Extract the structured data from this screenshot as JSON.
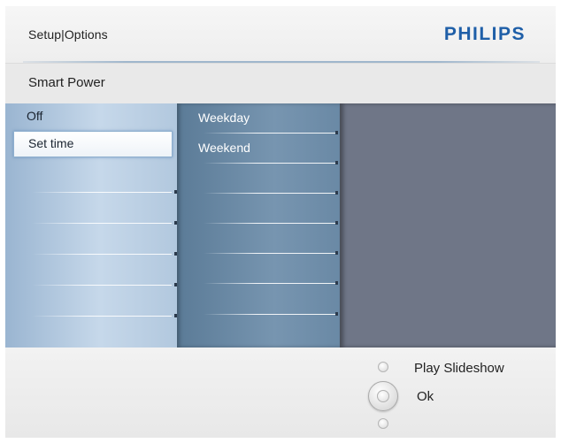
{
  "header": {
    "title": "Setup|Options",
    "brand": "PHILIPS"
  },
  "breadcrumb": {
    "label": "Smart Power"
  },
  "menu": {
    "level1": [
      {
        "label": "Off",
        "selected": false
      },
      {
        "label": "Set time",
        "selected": true
      }
    ],
    "level2": [
      {
        "label": "Weekday"
      },
      {
        "label": "Weekend"
      }
    ]
  },
  "footer": {
    "hints": [
      {
        "icon": "up-button-icon",
        "label": "Play Slideshow"
      },
      {
        "icon": "ok-button-icon",
        "label": "Ok"
      }
    ]
  },
  "colors": {
    "brand": "#1f5fa8",
    "menu_level1": "#b2c8de",
    "menu_level2": "#6a89a5",
    "content_area": "#6f7687"
  }
}
